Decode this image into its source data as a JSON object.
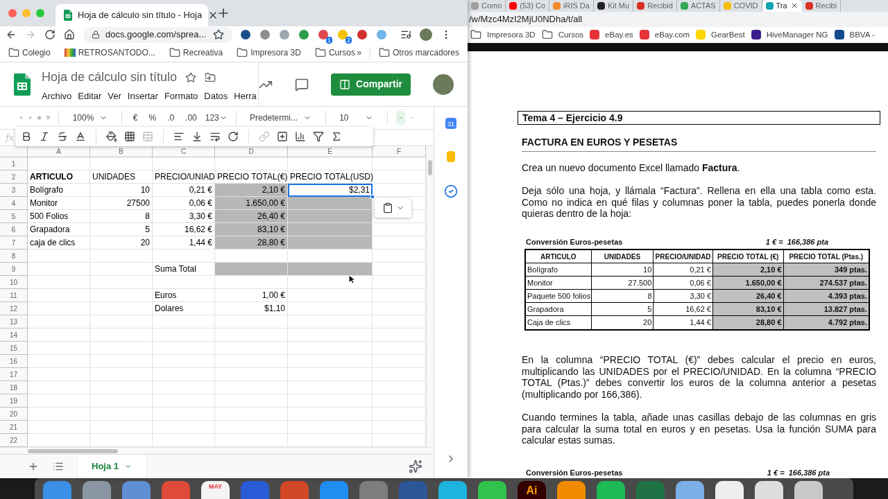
{
  "browser": {
    "tabs": [
      {
        "title": "Hoja de cálculo sin título - Hoja",
        "selected": true
      }
    ],
    "url": "docs.google.com/sprea...",
    "extensions": [
      {
        "color": "#1b4f8a"
      },
      {
        "color": "#8e8e8e"
      },
      {
        "color": "#9aa7b1"
      },
      {
        "color": "#2e9d4a"
      },
      {
        "color": "#e0474c",
        "badge": "1"
      },
      {
        "color": "#f2c300",
        "badge": "2"
      },
      {
        "color": "#d32f2f"
      },
      {
        "color": "#6fb7e8"
      }
    ],
    "bookmarks": [
      {
        "label": "Colegio",
        "kind": "folder"
      },
      {
        "label": "RETROSANTODO...",
        "kind": "site"
      },
      {
        "label": "Recreativa",
        "kind": "folder"
      },
      {
        "label": "Impresora 3D",
        "kind": "folder"
      },
      {
        "label": "Cursos",
        "kind": "folder"
      }
    ],
    "more_bookmarks": "»",
    "other_bookmarks": "Otros marcadores"
  },
  "sheets": {
    "title": "Hoja de cálculo sin título",
    "menu": [
      "Archivo",
      "Editar",
      "Ver",
      "Insertar",
      "Formato",
      "Datos",
      "Herra"
    ],
    "share_button": "Compartir",
    "toolbar": {
      "zoom": "100%",
      "currency": "€",
      "percent": "%",
      "decimals_less": ".0",
      "decimals_more": ".00",
      "number_format": "123",
      "font": "Predetermi...",
      "font_size": "10"
    },
    "formula_label": "fx",
    "calendar_day": "31",
    "columns": [
      "A",
      "B",
      "C",
      "D",
      "E",
      "F"
    ],
    "rows": [
      {
        "number": "1"
      },
      {
        "number": "2",
        "cells": [
          {
            "kind": "text",
            "text": "ARTICULO",
            "bold": true,
            "shaded": false,
            "selected": false
          },
          {
            "kind": "text",
            "text": "UNIDADES",
            "bold": false,
            "shaded": false,
            "selected": false
          },
          {
            "kind": "text",
            "text": "PRECIO/UNIAD",
            "bold": false,
            "shaded": false,
            "selected": false
          },
          {
            "kind": "text",
            "text": "PRECIO TOTAL(€)",
            "bold": false,
            "shaded": false,
            "selected": false
          },
          {
            "kind": "text",
            "text": "PRECIO TOTAL(USD)",
            "bold": false,
            "shaded": false,
            "selected": false
          }
        ]
      },
      {
        "number": "3",
        "cells": [
          {
            "kind": "text",
            "text": "Bolígrafo",
            "bold": false,
            "shaded": false,
            "selected": false
          },
          {
            "kind": "number",
            "text": "10",
            "bold": false,
            "shaded": false,
            "selected": false
          },
          {
            "kind": "number",
            "text": "0,21 €",
            "bold": false,
            "shaded": false,
            "selected": false
          },
          {
            "kind": "number",
            "text": "2,10 €",
            "bold": false,
            "shaded": true,
            "selected": false
          },
          {
            "kind": "number",
            "text": "$2,31",
            "bold": false,
            "shaded": false,
            "selected": true
          }
        ]
      },
      {
        "number": "4",
        "cells": [
          {
            "kind": "text",
            "text": "Monitor",
            "bold": false,
            "shaded": false,
            "selected": false
          },
          {
            "kind": "number",
            "text": "27500",
            "bold": false,
            "shaded": false,
            "selected": false
          },
          {
            "kind": "number",
            "text": "0,06 €",
            "bold": false,
            "shaded": false,
            "selected": false
          },
          {
            "kind": "number",
            "text": "1.650,00 €",
            "bold": false,
            "shaded": true,
            "selected": false
          },
          {
            "kind": "blank",
            "shaded": true,
            "selected": false
          }
        ]
      },
      {
        "number": "5",
        "cells": [
          {
            "kind": "text",
            "text": "500 Folios",
            "bold": false,
            "shaded": false,
            "selected": false
          },
          {
            "kind": "number",
            "text": "8",
            "bold": false,
            "shaded": false,
            "selected": false
          },
          {
            "kind": "number",
            "text": "3,30 €",
            "bold": false,
            "shaded": false,
            "selected": false
          },
          {
            "kind": "number",
            "text": "26,40 €",
            "bold": false,
            "shaded": true,
            "selected": false
          },
          {
            "kind": "blank",
            "shaded": true,
            "selected": false
          }
        ]
      },
      {
        "number": "6",
        "cells": [
          {
            "kind": "text",
            "text": "Grapadora",
            "bold": false,
            "shaded": false,
            "selected": false
          },
          {
            "kind": "number",
            "text": "5",
            "bold": false,
            "shaded": false,
            "selected": false
          },
          {
            "kind": "number",
            "text": "16,62 €",
            "bold": false,
            "shaded": false,
            "selected": false
          },
          {
            "kind": "number",
            "text": "83,10 €",
            "bold": false,
            "shaded": true,
            "selected": false
          },
          {
            "kind": "blank",
            "shaded": true,
            "selected": false
          }
        ]
      },
      {
        "number": "7",
        "cells": [
          {
            "kind": "text",
            "text": "caja de clics",
            "bold": false,
            "shaded": false,
            "selected": false
          },
          {
            "kind": "number",
            "text": "20",
            "bold": false,
            "shaded": false,
            "selected": false
          },
          {
            "kind": "number",
            "text": "1,44 €",
            "bold": false,
            "shaded": false,
            "selected": false
          },
          {
            "kind": "number",
            "text": "28,80 €",
            "bold": false,
            "shaded": true,
            "selected": false
          },
          {
            "kind": "blank",
            "shaded": true,
            "selected": false
          }
        ]
      },
      {
        "number": "8"
      },
      {
        "number": "9",
        "cells": [
          {
            "kind": "blank",
            "shaded": false,
            "selected": false
          },
          {
            "kind": "blank",
            "shaded": false,
            "selected": false
          },
          {
            "kind": "text",
            "text": "Suma Total",
            "bold": false,
            "shaded": false,
            "selected": false
          },
          {
            "kind": "blank",
            "shaded": true,
            "selected": false
          },
          {
            "kind": "blank",
            "shaded": true,
            "selected": false
          }
        ]
      },
      {
        "number": "10"
      },
      {
        "number": "11",
        "cells": [
          {
            "kind": "blank",
            "shaded": false,
            "selected": false
          },
          {
            "kind": "blank",
            "shaded": false,
            "selected": false
          },
          {
            "kind": "text",
            "text": "Euros",
            "bold": false,
            "shaded": false,
            "selected": false
          },
          {
            "kind": "number",
            "text": "1,00 €",
            "bold": false,
            "shaded": false,
            "selected": false
          }
        ]
      },
      {
        "number": "12",
        "cells": [
          {
            "kind": "blank",
            "shaded": false,
            "selected": false
          },
          {
            "kind": "blank",
            "shaded": false,
            "selected": false
          },
          {
            "kind": "text",
            "text": "Dolares",
            "bold": false,
            "shaded": false,
            "selected": false
          },
          {
            "kind": "number",
            "text": "$1,10",
            "bold": false,
            "shaded": false,
            "selected": false
          }
        ]
      },
      {
        "number": "13"
      },
      {
        "number": "14"
      },
      {
        "number": "15"
      },
      {
        "number": "16"
      },
      {
        "number": "17"
      },
      {
        "number": "18"
      },
      {
        "number": "19"
      },
      {
        "number": "20"
      },
      {
        "number": "21"
      },
      {
        "number": "22"
      }
    ],
    "sheet_tabs": [
      {
        "label": "Hoja 1",
        "selected": true
      }
    ]
  },
  "document_window": {
    "tabs": [
      {
        "title": "Como",
        "selected": false,
        "color": "#9e9e9e"
      },
      {
        "title": "(53) Co",
        "selected": false,
        "color": "#ff0000"
      },
      {
        "title": "iRIS Da",
        "selected": false,
        "color": "#f08c2a"
      },
      {
        "title": "Kit Mu",
        "selected": false,
        "color": "#222222"
      },
      {
        "title": "Recibid",
        "selected": false,
        "color": "#d93025"
      },
      {
        "title": "ACTAS",
        "selected": false,
        "color": "#34a853"
      },
      {
        "title": "COVID",
        "selected": false,
        "color": "#fbbc04"
      },
      {
        "title": "Tra",
        "selected": true,
        "color": "#12a4af"
      },
      {
        "title": "Recibi",
        "selected": false,
        "color": "#d93025"
      }
    ],
    "url": "/w/Mzc4MzI2MjU0NDha/t/all",
    "bookmarks": [
      {
        "label": "Impresora 3D",
        "kind": "folder"
      },
      {
        "label": "Cursos",
        "kind": "folder"
      },
      {
        "label": "eBay.es",
        "kind": "site",
        "color": "#e53238"
      },
      {
        "label": "eBay.com",
        "kind": "site",
        "color": "#e53238"
      },
      {
        "label": "GearBest",
        "kind": "site",
        "color": "#ffd500"
      },
      {
        "label": "HiveManager NG",
        "kind": "site",
        "color": "#3a1f8c"
      },
      {
        "label": "BBVA -",
        "kind": "site",
        "color": "#124a8c"
      }
    ],
    "document": {
      "exercise": "Tema 4 – Ejercicio 4.9",
      "heading": "FACTURA EN EUROS Y PESETAS",
      "paragraphs_top": [
        "Crea un nuevo documento Excel llamado **Factura**.",
        "Deja sólo una hoja, y llámala “Factura”. Rellena en ella una tabla como esta. Como no indica en qué filas y columnas poner la tabla, puedes ponerla donde quieras dentro de la hoja:"
      ],
      "table": {
        "caption": "Conversión Euros-pesetas",
        "rate": "1 € =  166,386 pta",
        "columns": [
          "ARTICULO",
          "UNIDADES",
          "PRECIO/UNIDAD",
          "PRECIO TOTAL (€)",
          "PRECIO TOTAL (Ptas.)"
        ],
        "rows": [
          [
            "Bolígrafo",
            "10",
            "0,21 €",
            "2,10 €",
            "349 ptas."
          ],
          [
            "Monitor",
            "27.500",
            "0,06 €",
            "1.650,00 €",
            "274.537 ptas."
          ],
          [
            "Paquete 500 folios",
            "8",
            "3,30 €",
            "26,40 €",
            "4.393 ptas."
          ],
          [
            "Grapadora",
            "5",
            "16,62 €",
            "83,10 €",
            "13.827 ptas."
          ],
          [
            "Caja de clics",
            "20",
            "1,44 €",
            "28,80 €",
            "4.792 ptas."
          ]
        ]
      },
      "paragraphs_bottom": [
        "En la columna “PRECIO TOTAL (€)” debes calcular el precio en euros, multiplicando las UNIDADES por el PRECIO/UNIDAD. En la columna “PRECIO TOTAL (Ptas.)” debes convertir los euros de la columna anterior a pesetas (multiplicando por 166,386).",
        "Cuando termines la tabla, añade unas casillas debajo de las columnas en gris para calcular la suma total en euros y en pesetas. Usa la función SUMA para calcular estas sumas."
      ],
      "next_table": {
        "caption": "Conversión Euros-pesetas",
        "rate": "1 € =  166,386 pta"
      }
    }
  },
  "dock": [
    {
      "color": "#3b8fe6"
    },
    {
      "color": "#8a96a3"
    },
    {
      "color": "#5e8fd4"
    },
    {
      "color": "#e04a3a"
    },
    {
      "color": "#f4f4f4",
      "label": "MAY"
    },
    {
      "color": "#2a5bd7"
    },
    {
      "color": "#d24726"
    },
    {
      "color": "#1e8ef2"
    },
    {
      "color": "#7d7d7d"
    },
    {
      "color": "#2b5797"
    },
    {
      "color": "#1fb3e0"
    },
    {
      "color": "#2fc24c"
    },
    {
      "color": "#330000",
      "label": "Ai"
    },
    {
      "color": "#f08a00"
    },
    {
      "color": "#1db954"
    },
    {
      "color": "#1f7244"
    },
    {
      "color": "#7bb0e6"
    },
    {
      "color": "#eeeeee"
    },
    {
      "color": "#dddddd"
    },
    {
      "color": "#c8c8c8"
    }
  ]
}
